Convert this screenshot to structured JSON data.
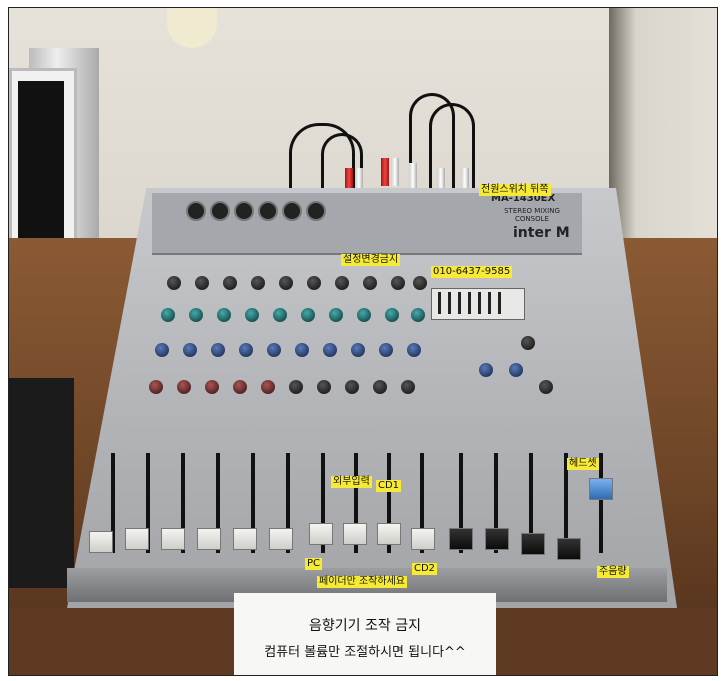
{
  "mixer": {
    "brand_logo": "inter M",
    "model_label": "MA-1430EX",
    "model_subtitle": "STEREO MIXING CONSOLE"
  },
  "labels": {
    "top_left_warning": "설정변경금지",
    "phone_number": "010-6437-9585",
    "top_right_note": "전원스위치 뒤쪽",
    "ch_pc": "PC",
    "ch_external": "외부입력",
    "ch_cd1": "CD1",
    "ch_cd2": "CD2",
    "fader_only": "페이더만 조작하세요",
    "monitor_fader": "헤드셋",
    "main_volume": "주음량"
  },
  "sign": {
    "line1": "음향기기 조작 금지",
    "line2": "컴퓨터 볼륨만 조절하시면 됩니다^^"
  },
  "colors": {
    "label_yellow": "#f6ea35",
    "desk_brown": "#6b4326",
    "mixer_silver": "#b3b5b8"
  }
}
